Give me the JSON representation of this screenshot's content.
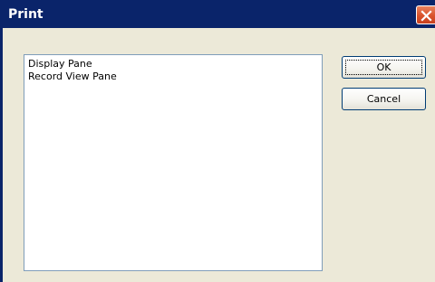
{
  "window": {
    "title": "Print",
    "close_icon": "close-icon"
  },
  "list": {
    "items": [
      {
        "label": "Display Pane"
      },
      {
        "label": "Record View Pane"
      }
    ]
  },
  "buttons": {
    "ok_label": "OK",
    "cancel_label": "Cancel"
  },
  "colors": {
    "titlebar": "#0A246A",
    "dialog_bg": "#ECE9D8",
    "close_button": "#D9532C",
    "list_border": "#7F9DB9",
    "button_border": "#003C74"
  }
}
